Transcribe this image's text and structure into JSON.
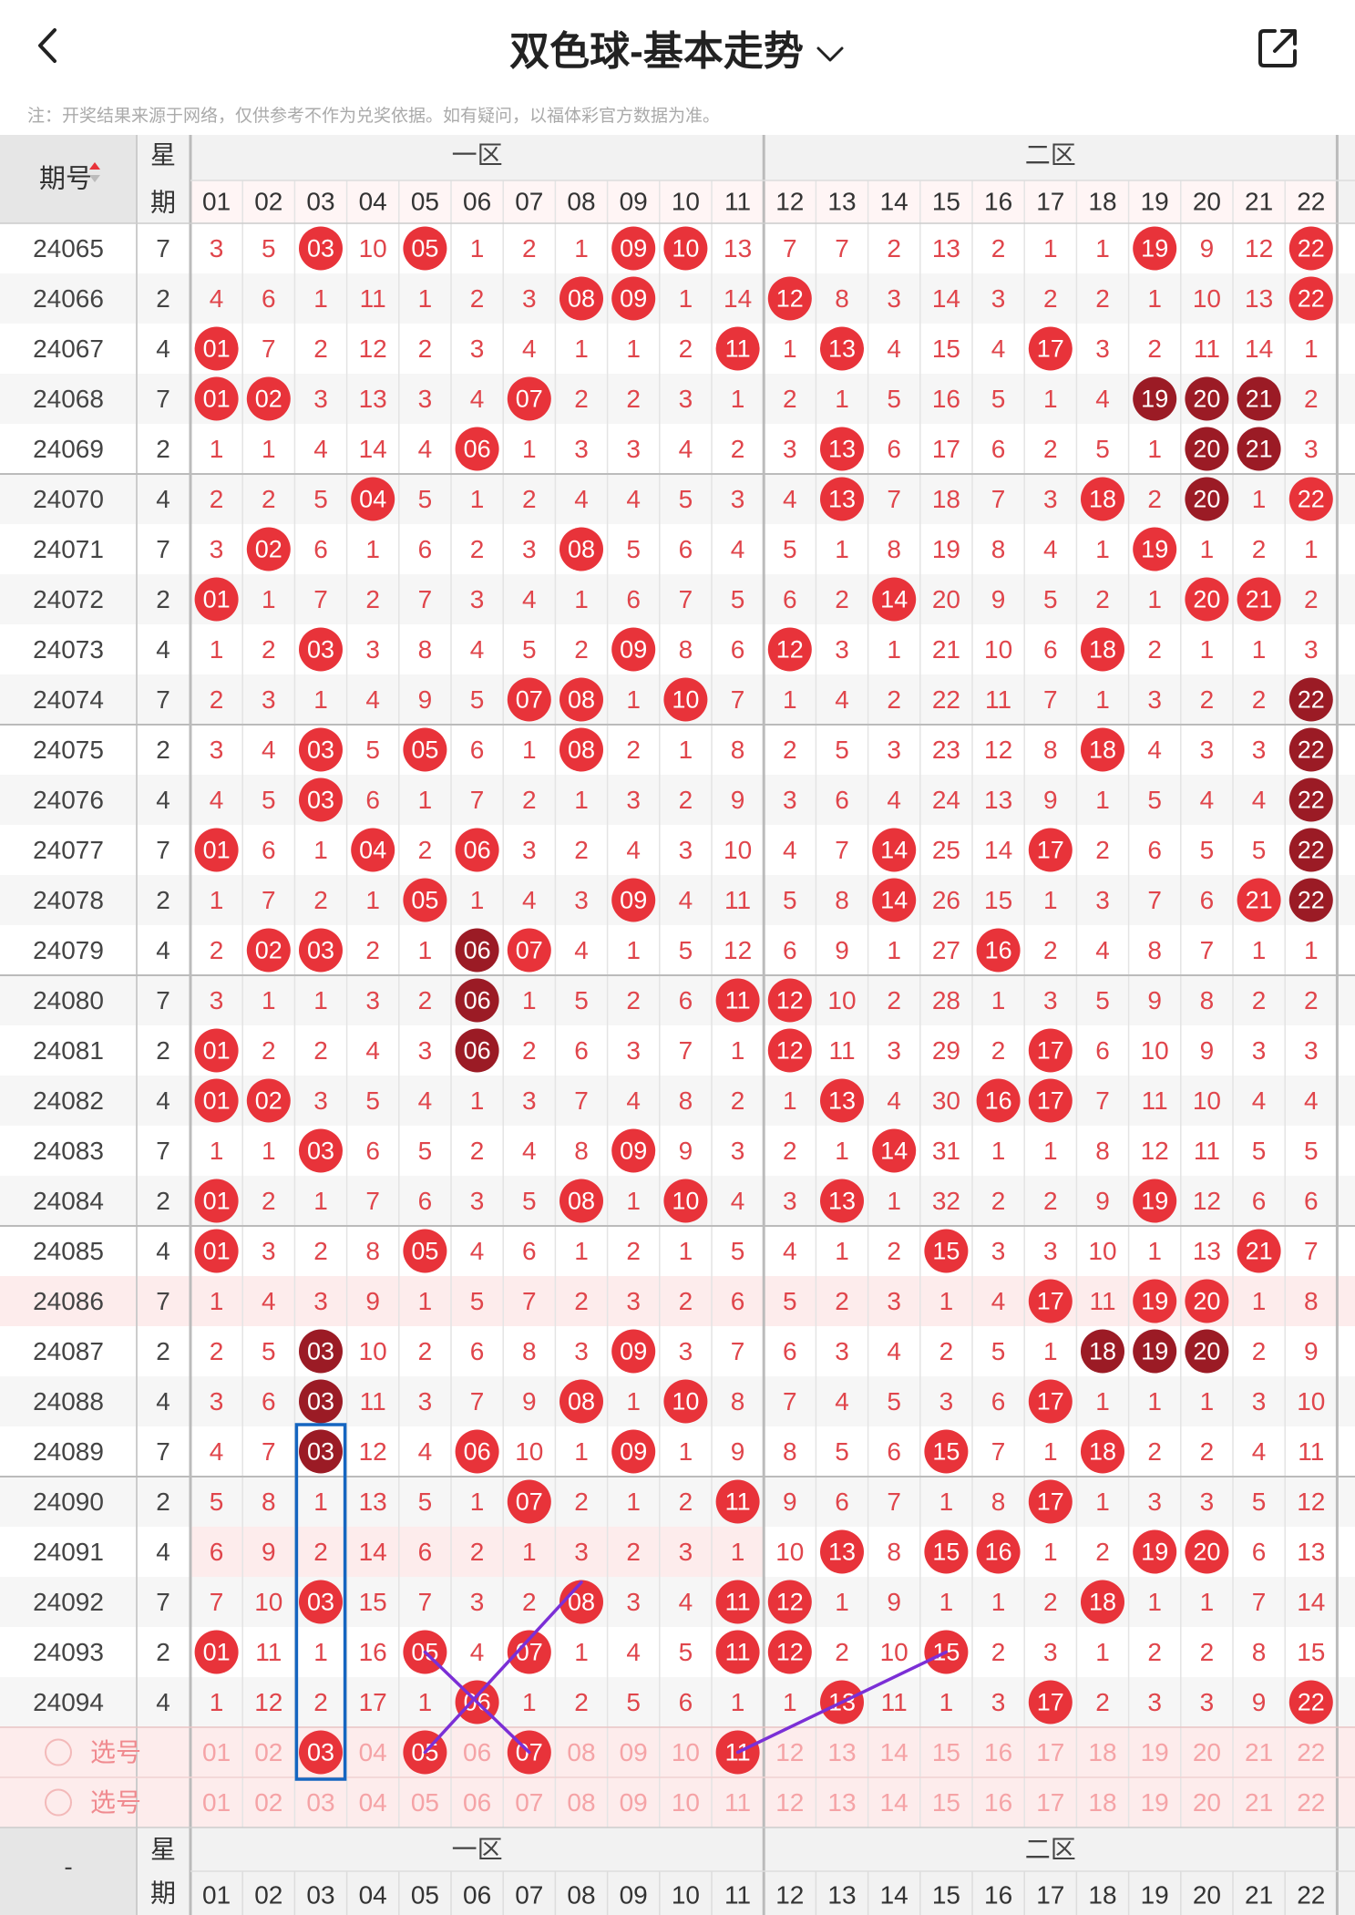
{
  "header": {
    "title": "双色球-基本走势"
  },
  "notice": "注：开奖结果来源于网络，仅供参考不作为兑奖依据。如有疑问，以福体彩官方数据为准。",
  "table": {
    "col_issue": "期号",
    "col_week": [
      "星",
      "期"
    ],
    "zone1": "一区",
    "zone2": "二区",
    "numbers": [
      "01",
      "02",
      "03",
      "04",
      "05",
      "06",
      "07",
      "08",
      "09",
      "10",
      "11",
      "12",
      "13",
      "14",
      "15",
      "16",
      "17",
      "18",
      "19",
      "20",
      "21",
      "22"
    ],
    "footer_issue": "-",
    "pick_label": "选号",
    "rows": [
      {
        "issue": "24065",
        "week": "7",
        "v": [
          3,
          5,
          "03",
          10,
          "05",
          1,
          2,
          1,
          "09",
          "10",
          13,
          7,
          7,
          2,
          13,
          2,
          1,
          1,
          "19",
          9,
          12,
          "22"
        ]
      },
      {
        "issue": "24066",
        "week": "2",
        "v": [
          4,
          6,
          1,
          11,
          1,
          2,
          3,
          "08",
          "09",
          1,
          14,
          "12",
          8,
          3,
          14,
          3,
          2,
          2,
          1,
          10,
          13,
          "22"
        ]
      },
      {
        "issue": "24067",
        "week": "4",
        "v": [
          "01",
          7,
          2,
          12,
          2,
          3,
          4,
          1,
          1,
          2,
          "11",
          1,
          "13",
          4,
          15,
          4,
          "17",
          3,
          2,
          11,
          14,
          1
        ]
      },
      {
        "issue": "24068",
        "week": "7",
        "v": [
          "01",
          "02",
          3,
          13,
          3,
          4,
          "07",
          2,
          2,
          3,
          1,
          2,
          1,
          5,
          16,
          5,
          1,
          4,
          "19",
          "20",
          "21",
          2
        ]
      },
      {
        "issue": "24069",
        "week": "2",
        "v": [
          1,
          1,
          4,
          14,
          4,
          "06",
          1,
          3,
          3,
          4,
          2,
          3,
          "13",
          6,
          17,
          6,
          2,
          5,
          1,
          "20",
          "21",
          3
        ]
      },
      {
        "issue": "24070",
        "week": "4",
        "v": [
          2,
          2,
          5,
          "04",
          5,
          1,
          2,
          4,
          4,
          5,
          3,
          4,
          "13",
          7,
          18,
          7,
          3,
          "18",
          2,
          "20",
          1,
          "22"
        ]
      },
      {
        "issue": "24071",
        "week": "7",
        "v": [
          3,
          "02",
          6,
          1,
          6,
          2,
          3,
          "08",
          5,
          6,
          4,
          5,
          1,
          8,
          19,
          8,
          4,
          1,
          "19",
          1,
          2,
          1
        ]
      },
      {
        "issue": "24072",
        "week": "2",
        "v": [
          "01",
          1,
          7,
          2,
          7,
          3,
          4,
          1,
          6,
          7,
          5,
          6,
          2,
          "14",
          20,
          9,
          5,
          2,
          1,
          "20",
          "21",
          2
        ]
      },
      {
        "issue": "24073",
        "week": "4",
        "v": [
          1,
          2,
          "03",
          3,
          8,
          4,
          5,
          2,
          "09",
          8,
          6,
          "12",
          3,
          1,
          21,
          10,
          6,
          "18",
          2,
          1,
          1,
          3
        ]
      },
      {
        "issue": "24074",
        "week": "7",
        "v": [
          2,
          3,
          1,
          4,
          9,
          5,
          "07",
          "08",
          1,
          "10",
          7,
          1,
          4,
          2,
          22,
          11,
          7,
          1,
          3,
          2,
          2,
          "22"
        ]
      },
      {
        "issue": "24075",
        "week": "2",
        "v": [
          3,
          4,
          "03",
          5,
          "05",
          6,
          1,
          "08",
          2,
          1,
          8,
          2,
          5,
          3,
          23,
          12,
          8,
          "18",
          4,
          3,
          3,
          "22"
        ]
      },
      {
        "issue": "24076",
        "week": "4",
        "v": [
          4,
          5,
          "03",
          6,
          1,
          7,
          2,
          1,
          3,
          2,
          9,
          3,
          6,
          4,
          24,
          13,
          9,
          1,
          5,
          4,
          4,
          "22"
        ]
      },
      {
        "issue": "24077",
        "week": "7",
        "v": [
          "01",
          6,
          1,
          "04",
          2,
          "06",
          3,
          2,
          4,
          3,
          10,
          4,
          7,
          "14",
          25,
          14,
          "17",
          2,
          6,
          5,
          5,
          "22"
        ]
      },
      {
        "issue": "24078",
        "week": "2",
        "v": [
          1,
          7,
          2,
          1,
          "05",
          1,
          4,
          3,
          "09",
          4,
          11,
          5,
          8,
          "14",
          26,
          15,
          1,
          3,
          7,
          6,
          "21",
          "22"
        ]
      },
      {
        "issue": "24079",
        "week": "4",
        "v": [
          2,
          "02",
          "03",
          2,
          1,
          "06",
          "07",
          4,
          1,
          5,
          12,
          6,
          9,
          1,
          27,
          "16",
          2,
          4,
          8,
          7,
          1,
          1
        ]
      },
      {
        "issue": "24080",
        "week": "7",
        "v": [
          3,
          1,
          1,
          3,
          2,
          "06",
          1,
          5,
          2,
          6,
          "11",
          "12",
          10,
          2,
          28,
          1,
          3,
          5,
          9,
          8,
          2,
          2
        ]
      },
      {
        "issue": "24081",
        "week": "2",
        "v": [
          "01",
          2,
          2,
          4,
          3,
          "06",
          2,
          6,
          3,
          7,
          1,
          "12",
          11,
          3,
          29,
          2,
          "17",
          6,
          10,
          9,
          3,
          3
        ]
      },
      {
        "issue": "24082",
        "week": "4",
        "v": [
          "01",
          "02",
          3,
          5,
          4,
          1,
          3,
          7,
          4,
          8,
          2,
          1,
          "13",
          4,
          30,
          "16",
          "17",
          7,
          11,
          10,
          4,
          4
        ]
      },
      {
        "issue": "24083",
        "week": "7",
        "v": [
          1,
          1,
          "03",
          6,
          5,
          2,
          4,
          8,
          "09",
          9,
          3,
          2,
          1,
          "14",
          31,
          1,
          1,
          8,
          12,
          11,
          5,
          5
        ]
      },
      {
        "issue": "24084",
        "week": "2",
        "v": [
          "01",
          2,
          1,
          7,
          6,
          3,
          5,
          "08",
          1,
          "10",
          4,
          3,
          "13",
          1,
          32,
          2,
          2,
          9,
          "19",
          12,
          6,
          6
        ]
      },
      {
        "issue": "24085",
        "week": "4",
        "v": [
          "01",
          3,
          2,
          8,
          "05",
          4,
          6,
          1,
          2,
          1,
          5,
          4,
          1,
          2,
          "15",
          3,
          3,
          10,
          1,
          13,
          "21",
          7
        ]
      },
      {
        "issue": "24086",
        "week": "7",
        "v": [
          1,
          4,
          3,
          9,
          1,
          5,
          7,
          2,
          3,
          2,
          6,
          5,
          2,
          3,
          1,
          4,
          "17",
          11,
          "19",
          "20",
          1,
          8
        ]
      },
      {
        "issue": "24087",
        "week": "2",
        "v": [
          2,
          5,
          "03",
          10,
          2,
          6,
          8,
          3,
          "09",
          3,
          7,
          6,
          3,
          4,
          2,
          5,
          1,
          "18",
          "19",
          "20",
          2,
          9
        ]
      },
      {
        "issue": "24088",
        "week": "4",
        "v": [
          3,
          6,
          "03",
          11,
          3,
          7,
          9,
          "08",
          1,
          "10",
          8,
          7,
          4,
          5,
          3,
          6,
          "17",
          1,
          1,
          1,
          3,
          10
        ]
      },
      {
        "issue": "24089",
        "week": "7",
        "v": [
          4,
          7,
          "03",
          12,
          4,
          "06",
          10,
          1,
          "09",
          1,
          9,
          8,
          5,
          6,
          "15",
          7,
          1,
          "18",
          2,
          2,
          4,
          11
        ]
      },
      {
        "issue": "24090",
        "week": "2",
        "v": [
          5,
          8,
          1,
          13,
          5,
          1,
          "07",
          2,
          1,
          2,
          "11",
          9,
          6,
          7,
          1,
          8,
          "17",
          1,
          3,
          3,
          5,
          12
        ]
      },
      {
        "issue": "24091",
        "week": "4",
        "v": [
          6,
          9,
          2,
          14,
          6,
          2,
          1,
          3,
          2,
          3,
          1,
          10,
          "13",
          8,
          "15",
          "16",
          1,
          2,
          "19",
          "20",
          6,
          13
        ]
      },
      {
        "issue": "24092",
        "week": "7",
        "v": [
          7,
          10,
          "03",
          15,
          7,
          3,
          2,
          "08",
          3,
          4,
          "11",
          "12",
          1,
          9,
          1,
          1,
          2,
          "18",
          1,
          1,
          7,
          14
        ]
      },
      {
        "issue": "24093",
        "week": "2",
        "v": [
          "01",
          11,
          1,
          16,
          "05",
          4,
          "07",
          1,
          4,
          5,
          "11",
          "12",
          2,
          10,
          "15",
          2,
          3,
          1,
          2,
          2,
          8,
          15
        ]
      },
      {
        "issue": "24094",
        "week": "4",
        "v": [
          1,
          12,
          2,
          17,
          1,
          "06",
          1,
          2,
          5,
          6,
          1,
          1,
          "13",
          11,
          1,
          3,
          "17",
          2,
          3,
          3,
          9,
          "22"
        ]
      }
    ],
    "pick1_selected": [
      "03",
      "05",
      "07",
      "11"
    ]
  },
  "colors": {
    "red": "#e8333a",
    "dark_red": "#9b1b25",
    "blue_box": "#1565c0",
    "purple_line": "#7b2fd6"
  }
}
